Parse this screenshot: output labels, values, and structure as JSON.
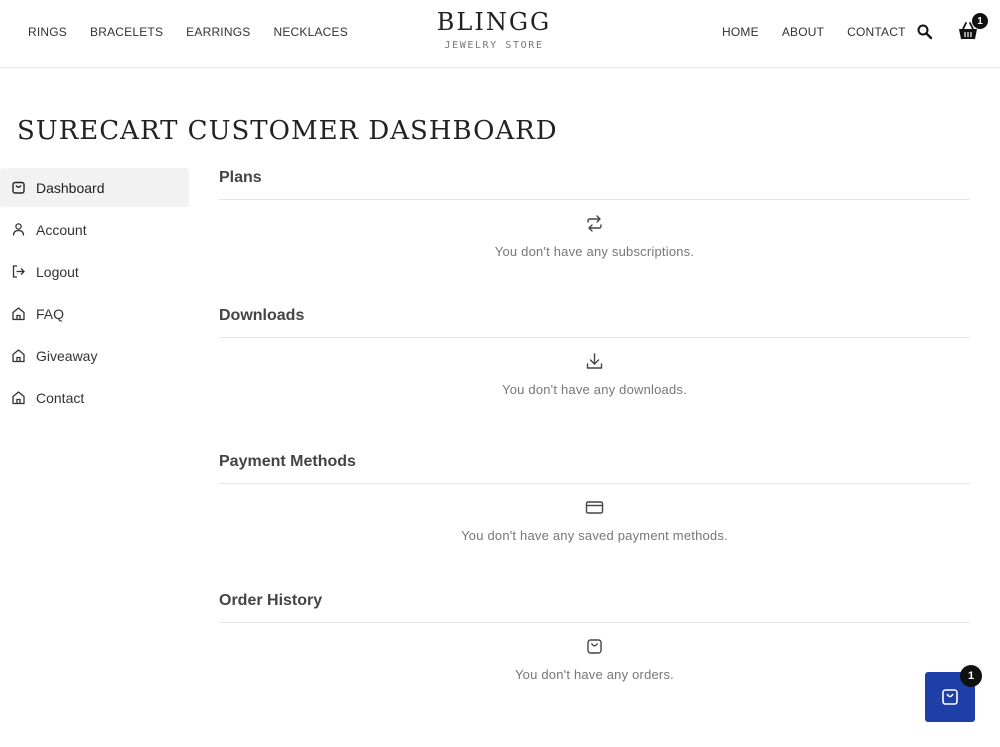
{
  "header": {
    "nav_left": [
      "RINGS",
      "BRACELETS",
      "EARRINGS",
      "NECKLACES"
    ],
    "brand_name": "BLINGG",
    "brand_sub": "JEWELRY STORE",
    "nav_right": [
      "HOME",
      "ABOUT",
      "CONTACT"
    ],
    "cart_count": "1",
    "icons": {
      "search": "search-icon",
      "cart": "basket-icon"
    }
  },
  "page_title": "SURECART CUSTOMER DASHBOARD",
  "sidebar": {
    "items": [
      {
        "label": "Dashboard",
        "icon": "bag-icon",
        "active": true
      },
      {
        "label": "Account",
        "icon": "user-icon",
        "active": false
      },
      {
        "label": "Logout",
        "icon": "logout-icon",
        "active": false
      },
      {
        "label": "FAQ",
        "icon": "home-icon",
        "active": false
      },
      {
        "label": "Giveaway",
        "icon": "home-icon",
        "active": false
      },
      {
        "label": "Contact",
        "icon": "home-icon",
        "active": false
      }
    ]
  },
  "sections": [
    {
      "title": "Plans",
      "empty_text": "You don't have any subscriptions.",
      "icon": "repeat-icon"
    },
    {
      "title": "Downloads",
      "empty_text": "You don't have any downloads.",
      "icon": "download-icon"
    },
    {
      "title": "Payment Methods",
      "empty_text": "You don't have any saved payment methods.",
      "icon": "credit-card-icon"
    },
    {
      "title": "Order History",
      "empty_text": "You don't have any orders.",
      "icon": "bag-icon"
    }
  ],
  "floating_cart": {
    "count": "1",
    "icon": "bag-icon",
    "color": "#1e3fa8"
  }
}
